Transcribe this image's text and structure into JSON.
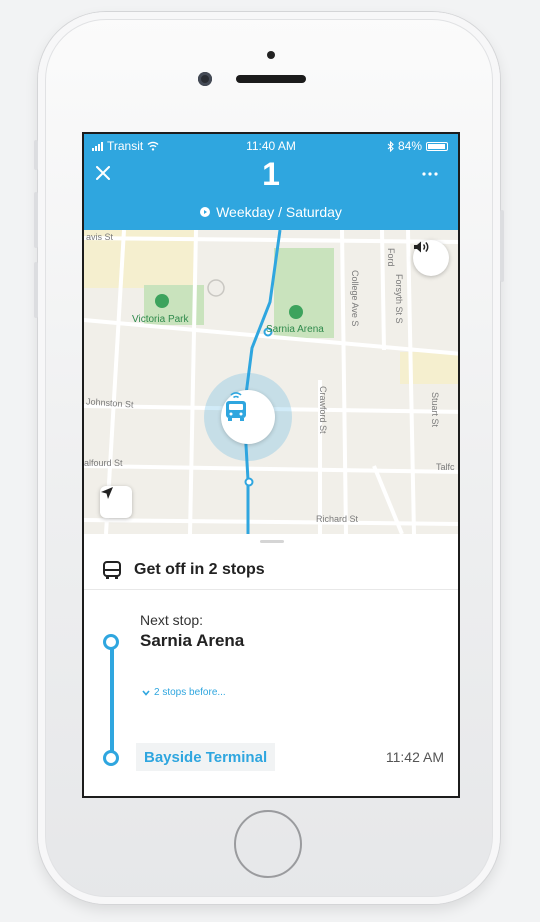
{
  "status_bar": {
    "carrier": "Transit",
    "time": "11:40 AM",
    "battery": "84%"
  },
  "header": {
    "close_icon": "close-icon",
    "route_number": "1",
    "more_icon": "more-icon",
    "schedule": "Weekday / Saturday"
  },
  "map": {
    "labels": {
      "victoria_park": "Victoria Park",
      "sarnia_arena": "Sarnia Arena",
      "college_ave": "College Ave S",
      "forsyth": "Forsyth St S",
      "johnston": "Johnston St",
      "crawford": "Crawford St",
      "stuart": "Stuart St",
      "alfourd": "alfourd St",
      "talfourd": "Talfc",
      "richard": "Richard St",
      "davis": "avis St",
      "ford": "Ford"
    },
    "sound_icon": "speaker-icon",
    "locate_icon": "location-arrow-icon",
    "bus_icon": "bus-icon"
  },
  "panel": {
    "get_off": "Get off in 2 stops",
    "next_stop_label": "Next stop:",
    "next_stop_name": "Sarnia Arena",
    "stops_before": "2 stops before...",
    "terminal_name": "Bayside Terminal",
    "arrival_time": "11:42 AM"
  },
  "colors": {
    "accent": "#2fa6df",
    "park_green": "#c9e3bd"
  }
}
